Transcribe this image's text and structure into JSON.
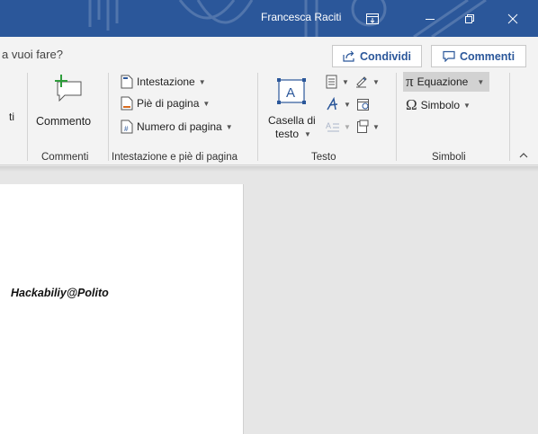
{
  "titlebar": {
    "user_name": "Francesca Raciti",
    "ribbon_toggle_icon": "ribbon-display-icon",
    "minimize_icon": "minimize-icon",
    "restore_icon": "restore-icon",
    "close_icon": "close-icon"
  },
  "tellme": {
    "text": "a vuoi fare?"
  },
  "share": {
    "label": "Condividi",
    "icon": "share-icon"
  },
  "comments": {
    "label": "Commenti",
    "icon": "comment-icon"
  },
  "ribbon": {
    "partial_label": "ti",
    "comment_button": "Commento",
    "comments_group": "Commenti",
    "header": "Intestazione",
    "footer": "Piè di pagina",
    "page_number": "Numero di pagina",
    "header_footer_group": "Intestazione e piè di pagina",
    "textbox_line1": "Casella di",
    "textbox_line2": "testo",
    "text_group": "Testo",
    "equation": "Equazione",
    "symbol": "Simbolo",
    "symbols_group": "Simboli",
    "equation_glyph": "π",
    "symbol_glyph": "Ω",
    "collapse_icon": "chevron-up-icon"
  },
  "document": {
    "text": "Hackabiliy@Polito"
  },
  "colors": {
    "titlebar": "#2b579a",
    "accent": "#2b579a",
    "ribbon_bg": "#f3f3f3"
  }
}
